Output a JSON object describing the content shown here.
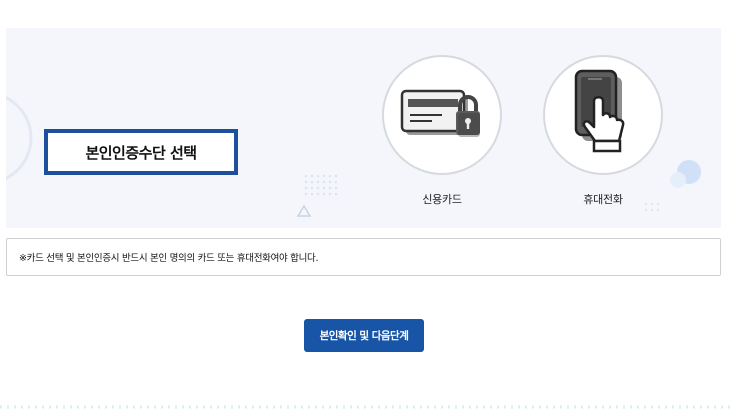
{
  "section": {
    "title": "본인인증수단 선택"
  },
  "methods": [
    {
      "label": "신용카드",
      "icon": "credit-card-lock-icon"
    },
    {
      "label": "휴대전화",
      "icon": "mobile-phone-hand-icon"
    }
  ],
  "notice": {
    "text": "※카드 선택 및 본인인증시 반드시 본인 명의의 카드 또는 휴대전화여야 합니다."
  },
  "actions": {
    "next_label": "본인확인 및 다음단계"
  },
  "colors": {
    "accent": "#1d4f9c",
    "button": "#1955a6",
    "banner_bg": "#f4f6fb"
  }
}
